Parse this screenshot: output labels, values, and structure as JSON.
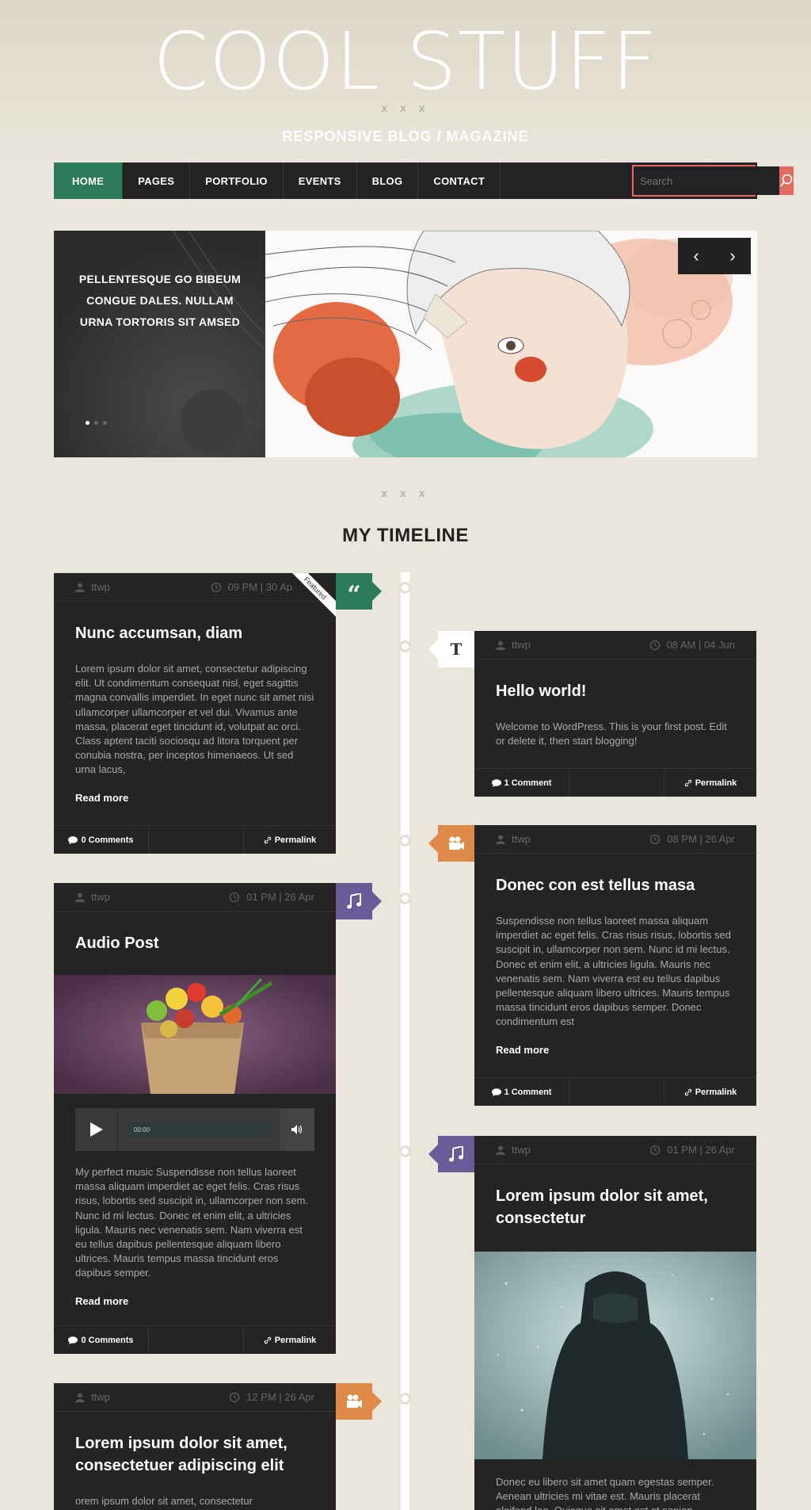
{
  "site": {
    "title": "COOL STUFF",
    "divider": "x x x",
    "tagline": "RESPONSIVE BLOG / MAGAZINE"
  },
  "nav": {
    "items": [
      "HOME",
      "PAGES",
      "PORTFOLIO",
      "EVENTS",
      "BLOG",
      "CONTACT"
    ],
    "search_placeholder": "Search"
  },
  "slider": {
    "caption": "PELLENTESQUE GO BIBEUM CONGUE DALES. NULLAM URNA TORTORIS SIT AMSED",
    "prev": "‹",
    "next": "›"
  },
  "section": {
    "divider": "x x x",
    "title": "MY TIMELINE"
  },
  "posts": [
    {
      "author": "ttwp",
      "time": "09 PM | 30 Ap",
      "badge": "Featured",
      "format_glyph": "“",
      "title": "Nunc accumsan, diam",
      "excerpt": "Lorem ipsum dolor sit amet, consectetur adipiscing elit. Ut condimentum consequat nisl, eget sagittis magna convallis imperdiet. In eget nunc sit amet nisi ullamcorper ullamcorper et vel dui. Vivamus ante massa, placerat eget tincidunt id, volutpat ac orci. Class aptent taciti sociosqu ad litora torquent per conubia nostra, per inceptos himenaeos. Ut sed urna lacus,",
      "read_more": "Read more",
      "comments": "0 Comments",
      "permalink": "Permalink"
    },
    {
      "author": "ttwp",
      "time": "08 AM | 04 Jun",
      "format_glyph": "T",
      "title": "Hello world!",
      "excerpt": "Welcome to WordPress. This is your first post. Edit or delete it, then start blogging!",
      "comments": "1 Comment",
      "permalink": "Permalink"
    },
    {
      "author": "ttwp",
      "time": "08 PM | 26 Apr",
      "title": "Donec con est tellus masa",
      "excerpt": "Suspendisse non tellus laoreet massa aliquam imperdiet ac eget felis. Cras risus risus, lobortis sed suscipit in, ullamcorper non sem. Nunc id mi lectus. Donec et enim elit, a ultricies ligula. Mauris nec venenatis sem. Nam viverra est eu tellus dapibus pellentesque aliquam libero ultrices. Mauris tempus massa tincidunt eros dapibus semper. Donec condimentum est",
      "read_more": "Read more",
      "comments": "1 Comment",
      "permalink": "Permalink"
    },
    {
      "author": "ttwp",
      "time": "01 PM | 26 Apr",
      "title": "Audio Post",
      "audio_time": "00:00",
      "excerpt": "My perfect music Suspendisse non tellus laoreet massa aliquam imperdiet ac eget felis. Cras risus risus, lobortis sed suscipit in, ullamcorper non sem. Nunc id mi lectus. Donec et enim elit, a ultricies ligula. Mauris nec venenatis sem. Nam viverra est eu tellus dapibus pellentesque aliquam libero ultrices. Mauris tempus massa tincidunt eros dapibus semper.",
      "read_more": "Read more",
      "comments": "0 Comments",
      "permalink": "Permalink"
    },
    {
      "author": "ttwp",
      "time": "01 PM | 26 Apr",
      "title": "Lorem ipsum dolor sit amet, consectetur",
      "excerpt": "Donec eu libero sit amet quam egestas semper. Aenean ultricies mi vitae est. Mauris placerat eleifend leo. Quisque sit amet est et sapien"
    },
    {
      "author": "ttwp",
      "time": "12 PM | 26 Apr",
      "title": "Lorem ipsum dolor sit amet, consectetuer adipiscing elit",
      "excerpt": "orem ipsum dolor sit amet, consectetur"
    }
  ],
  "colors": {
    "green": "#2d7a5a",
    "orange": "#e08a4a",
    "purple": "#6b5a98",
    "coral": "#e36b61",
    "card": "#242424"
  }
}
